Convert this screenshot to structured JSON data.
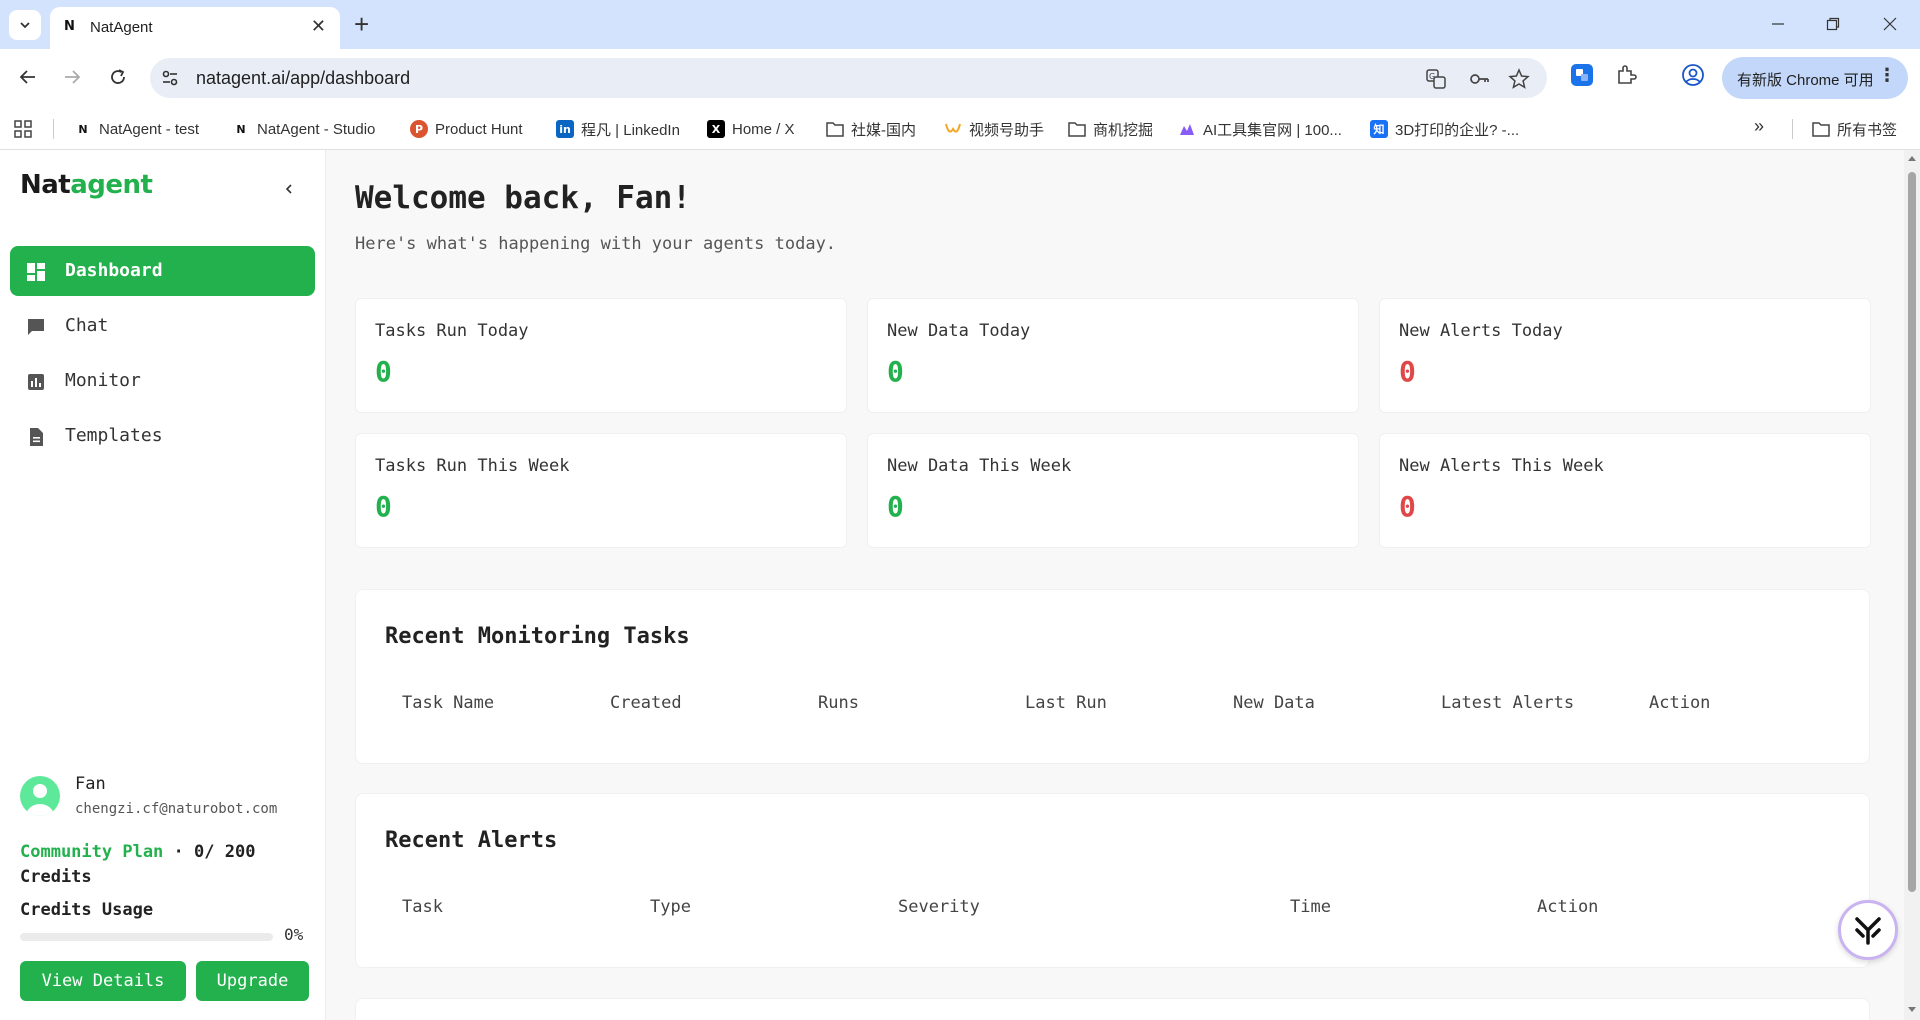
{
  "browser": {
    "tab_title": "NatAgent",
    "tab_favicon": "N",
    "url": "natagent.ai/app/dashboard",
    "update_label": "有新版 Chrome 可用",
    "bookmarks": [
      {
        "label": "NatAgent - test",
        "icon": "N"
      },
      {
        "label": "NatAgent - Studio",
        "icon": "N"
      },
      {
        "label": "Product Hunt",
        "icon": "P"
      },
      {
        "label": "程凡 | LinkedIn",
        "icon": "in"
      },
      {
        "label": "Home / X",
        "icon": "X"
      },
      {
        "label": "社媒-国内",
        "icon": "folder"
      },
      {
        "label": "视频号助手",
        "icon": "W"
      },
      {
        "label": "商机挖掘",
        "icon": "folder"
      },
      {
        "label": "AI工具集官网 | 100...",
        "icon": "ai"
      },
      {
        "label": "3D打印的企业? -...",
        "icon": "知"
      }
    ],
    "all_bookmarks_label": "所有书签"
  },
  "sidebar": {
    "logo_part1": "Nat",
    "logo_part2": "agent",
    "nav": [
      {
        "label": "Dashboard",
        "icon": "dashboard-icon",
        "active": true
      },
      {
        "label": "Chat",
        "icon": "chat-icon"
      },
      {
        "label": "Monitor",
        "icon": "monitor-icon"
      },
      {
        "label": "Templates",
        "icon": "templates-icon"
      }
    ],
    "user": {
      "name": "Fan",
      "email": "chengzi.cf@naturobot.com"
    },
    "plan": {
      "name": "Community Plan",
      "separator": " · ",
      "credits_text": "0/ 200 Credits"
    },
    "usage": {
      "label": "Credits Usage",
      "percent_text": "0%",
      "fraction": 0.0
    },
    "view_details_label": "View Details",
    "upgrade_label": "Upgrade"
  },
  "main": {
    "welcome": "Welcome back, Fan!",
    "subtitle": "Here's what's happening with your agents today.",
    "stats": [
      {
        "label": "Tasks Run Today",
        "value": "0",
        "color": "#22b14c"
      },
      {
        "label": "New Data Today",
        "value": "0",
        "color": "#22b14c"
      },
      {
        "label": "New Alerts Today",
        "value": "0",
        "color": "#e04848"
      },
      {
        "label": "Tasks Run This Week",
        "value": "0",
        "color": "#22b14c"
      },
      {
        "label": "New Data This Week",
        "value": "0",
        "color": "#22b14c"
      },
      {
        "label": "New Alerts This Week",
        "value": "0",
        "color": "#e04848"
      }
    ],
    "monitoring": {
      "title": "Recent Monitoring Tasks",
      "columns": [
        "Task Name",
        "Created",
        "Runs",
        "Last Run",
        "New Data",
        "Latest Alerts",
        "Action"
      ]
    },
    "alerts": {
      "title": "Recent Alerts",
      "columns": [
        "Task",
        "Type",
        "Severity",
        "Time",
        "Action"
      ]
    }
  },
  "colors": {
    "brand_green": "#23b14d",
    "alert_red": "#e04848"
  }
}
